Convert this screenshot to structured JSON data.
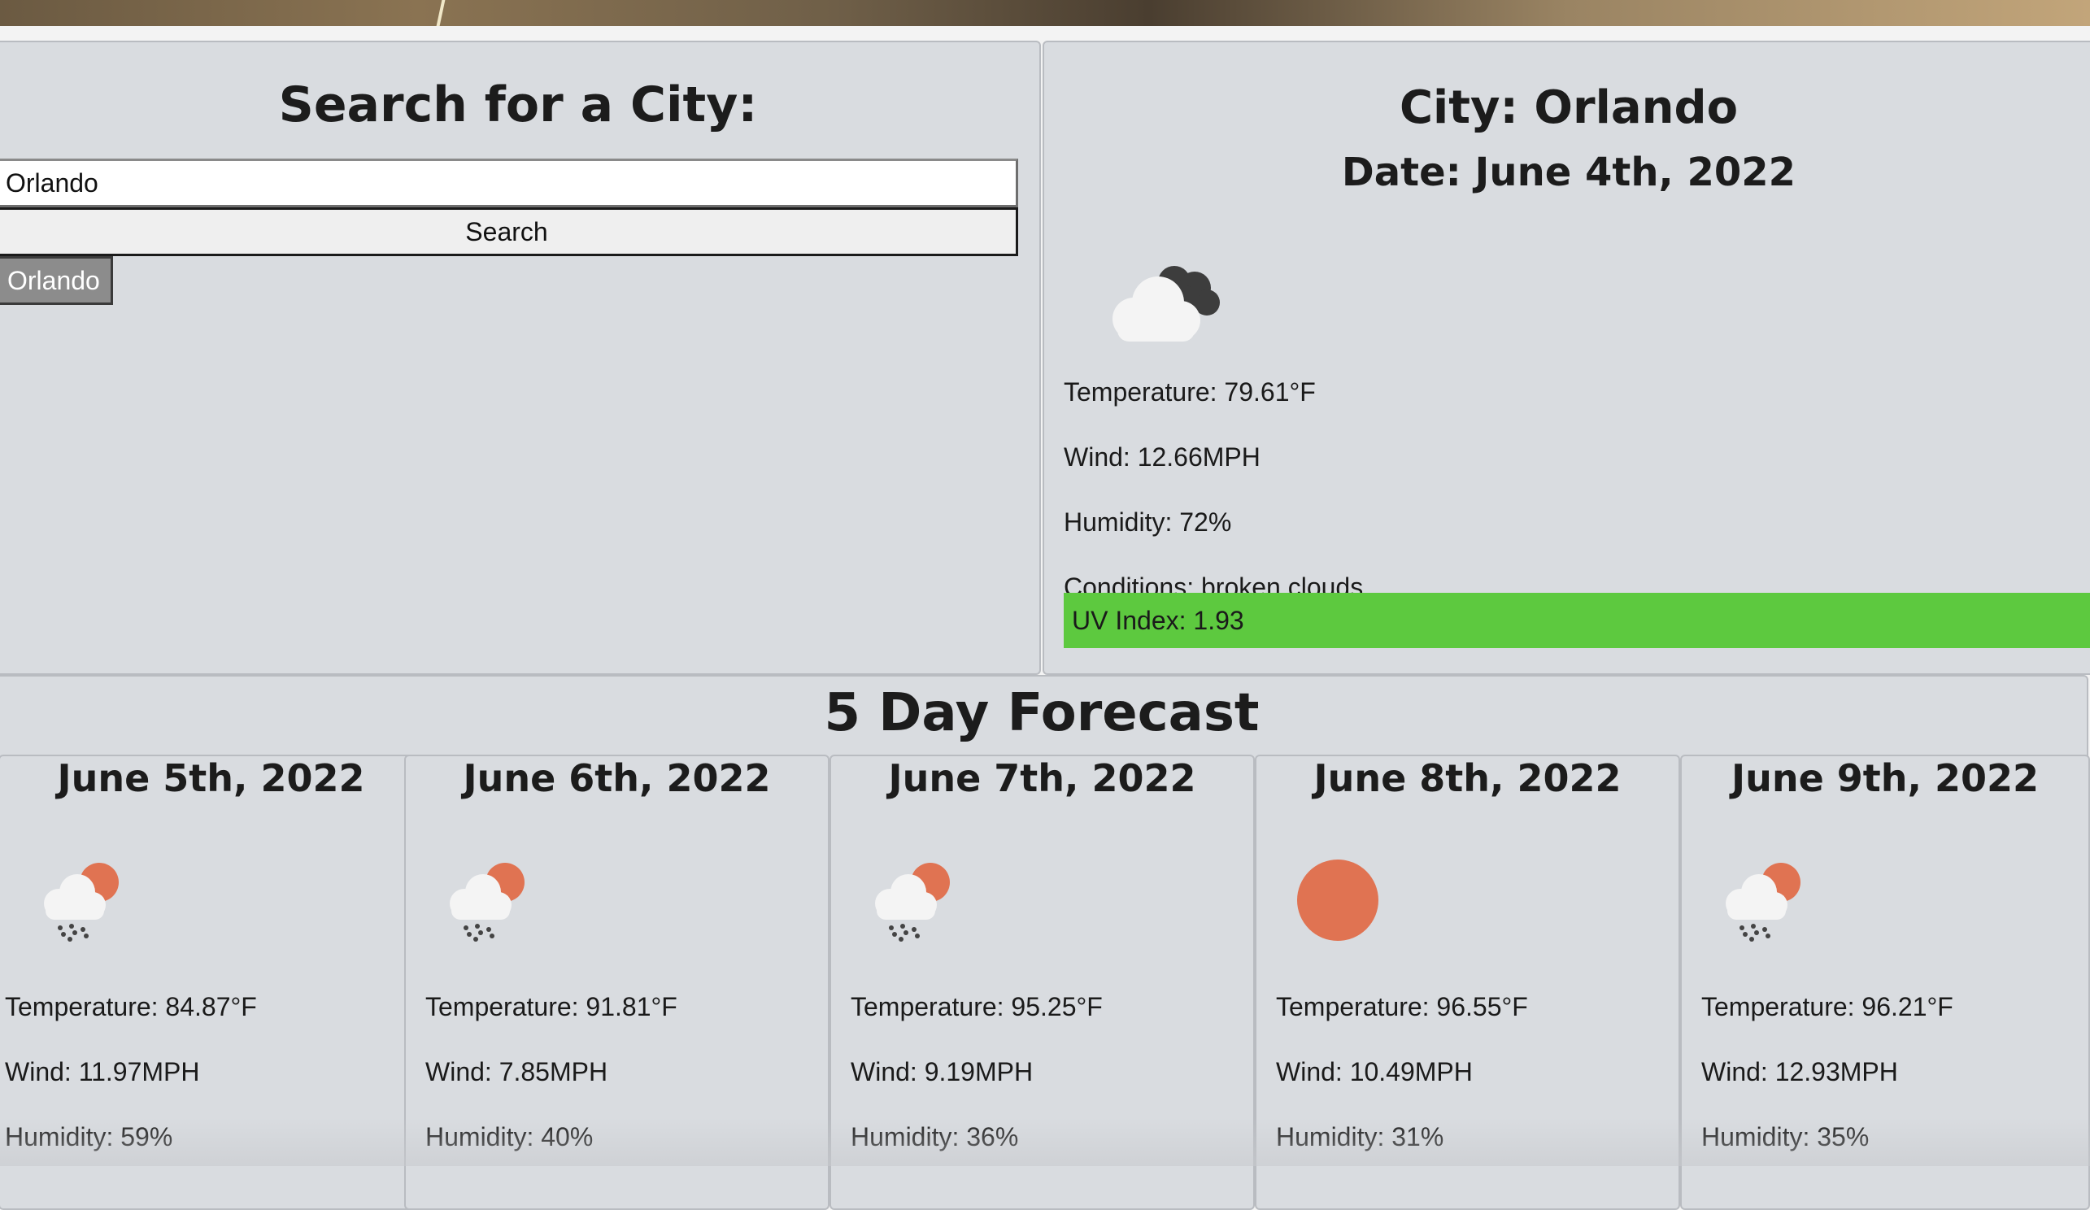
{
  "search": {
    "title": "Search for a City:",
    "input_value": "Orlando",
    "button_label": "Search",
    "history": [
      "Orlando"
    ]
  },
  "current": {
    "city": "City: Orlando",
    "date": "Date: June 4th, 2022",
    "icon": "broken-clouds-icon",
    "temperature": "Temperature: 79.61°F",
    "wind": "Wind: 12.66MPH",
    "humidity": "Humidity: 72%",
    "conditions": "Conditions: broken clouds",
    "uv": "UV Index: 1.93",
    "uv_color": "#5dc93f"
  },
  "forecast": {
    "title": "5 Day Forecast",
    "days": [
      {
        "date": "June 5th, 2022",
        "icon": "sun-cloud-rain-icon",
        "temperature": "Temperature: 84.87°F",
        "wind": "Wind: 11.97MPH",
        "humidity": "Humidity: 59%"
      },
      {
        "date": "June 6th, 2022",
        "icon": "sun-cloud-rain-icon",
        "temperature": "Temperature: 91.81°F",
        "wind": "Wind: 7.85MPH",
        "humidity": "Humidity: 40%"
      },
      {
        "date": "June 7th, 2022",
        "icon": "sun-cloud-rain-icon",
        "temperature": "Temperature: 95.25°F",
        "wind": "Wind: 9.19MPH",
        "humidity": "Humidity: 36%"
      },
      {
        "date": "June 8th, 2022",
        "icon": "sun-icon",
        "temperature": "Temperature: 96.55°F",
        "wind": "Wind: 10.49MPH",
        "humidity": "Humidity: 31%"
      },
      {
        "date": "June 9th, 2022",
        "icon": "sun-cloud-rain-icon",
        "temperature": "Temperature: 96.21°F",
        "wind": "Wind: 12.93MPH",
        "humidity": "Humidity: 35%"
      }
    ]
  },
  "colors": {
    "panel": "#d9dce0",
    "sun": "#e07352",
    "uv_low": "#5dc93f"
  }
}
